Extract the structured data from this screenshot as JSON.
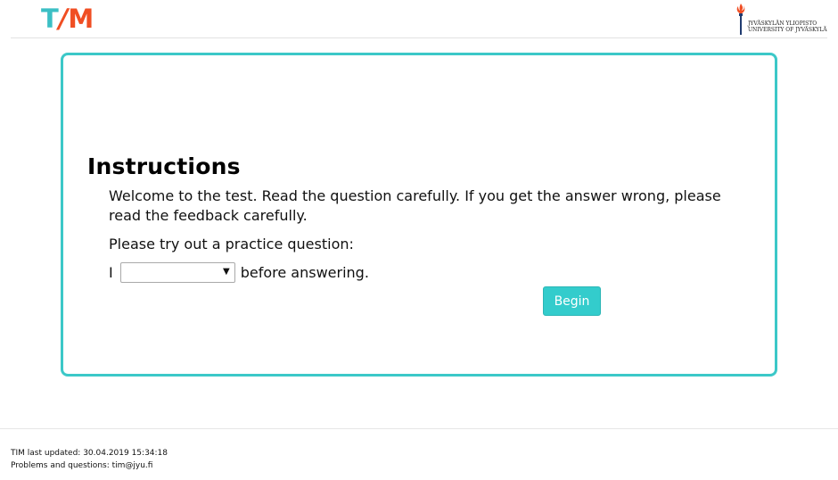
{
  "header": {
    "logo": {
      "t": "T",
      "slash": "/",
      "m": "M"
    },
    "university": {
      "line1": "JYVÄSKYLÄN YLIOPISTO",
      "line2": "UNIVERSITY OF JYVÄSKYLÄ"
    }
  },
  "card": {
    "title": "Instructions",
    "paragraph1": "Welcome to the test. Read the question carefully. If you get the answer wrong, please read the feedback carefully.",
    "paragraph2": "Please try out a practice question:",
    "practice": {
      "prefix": "I",
      "select_value": "",
      "suffix": "before answering."
    },
    "begin_label": "Begin"
  },
  "footer": {
    "updated": "TIM last updated: 30.04.2019 15:34:18",
    "contact": "Problems and questions: tim@jyu.fi"
  },
  "colors": {
    "accent": "#33cccc",
    "logo_teal": "#3bbfc4",
    "logo_orange": "#f04e23"
  }
}
